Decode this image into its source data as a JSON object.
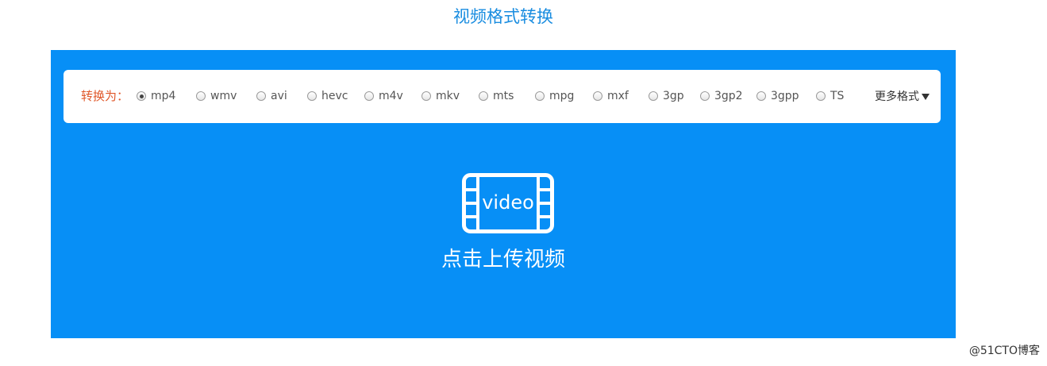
{
  "title": "视频格式转换",
  "format_bar": {
    "label": "转换为：",
    "selected": "mp4",
    "options": [
      "mp4",
      "wmv",
      "avi",
      "hevc",
      "m4v",
      "mkv",
      "mts",
      "mpg",
      "mxf",
      "3gp",
      "3gp2",
      "3gpp",
      "TS"
    ],
    "more_label": "更多格式"
  },
  "upload": {
    "icon_text": "video",
    "label": "点击上传视频"
  },
  "watermark": "@51CTO博客",
  "colors": {
    "panel": "#078ff6",
    "title": "#1a8de0",
    "label": "#e0582a"
  }
}
